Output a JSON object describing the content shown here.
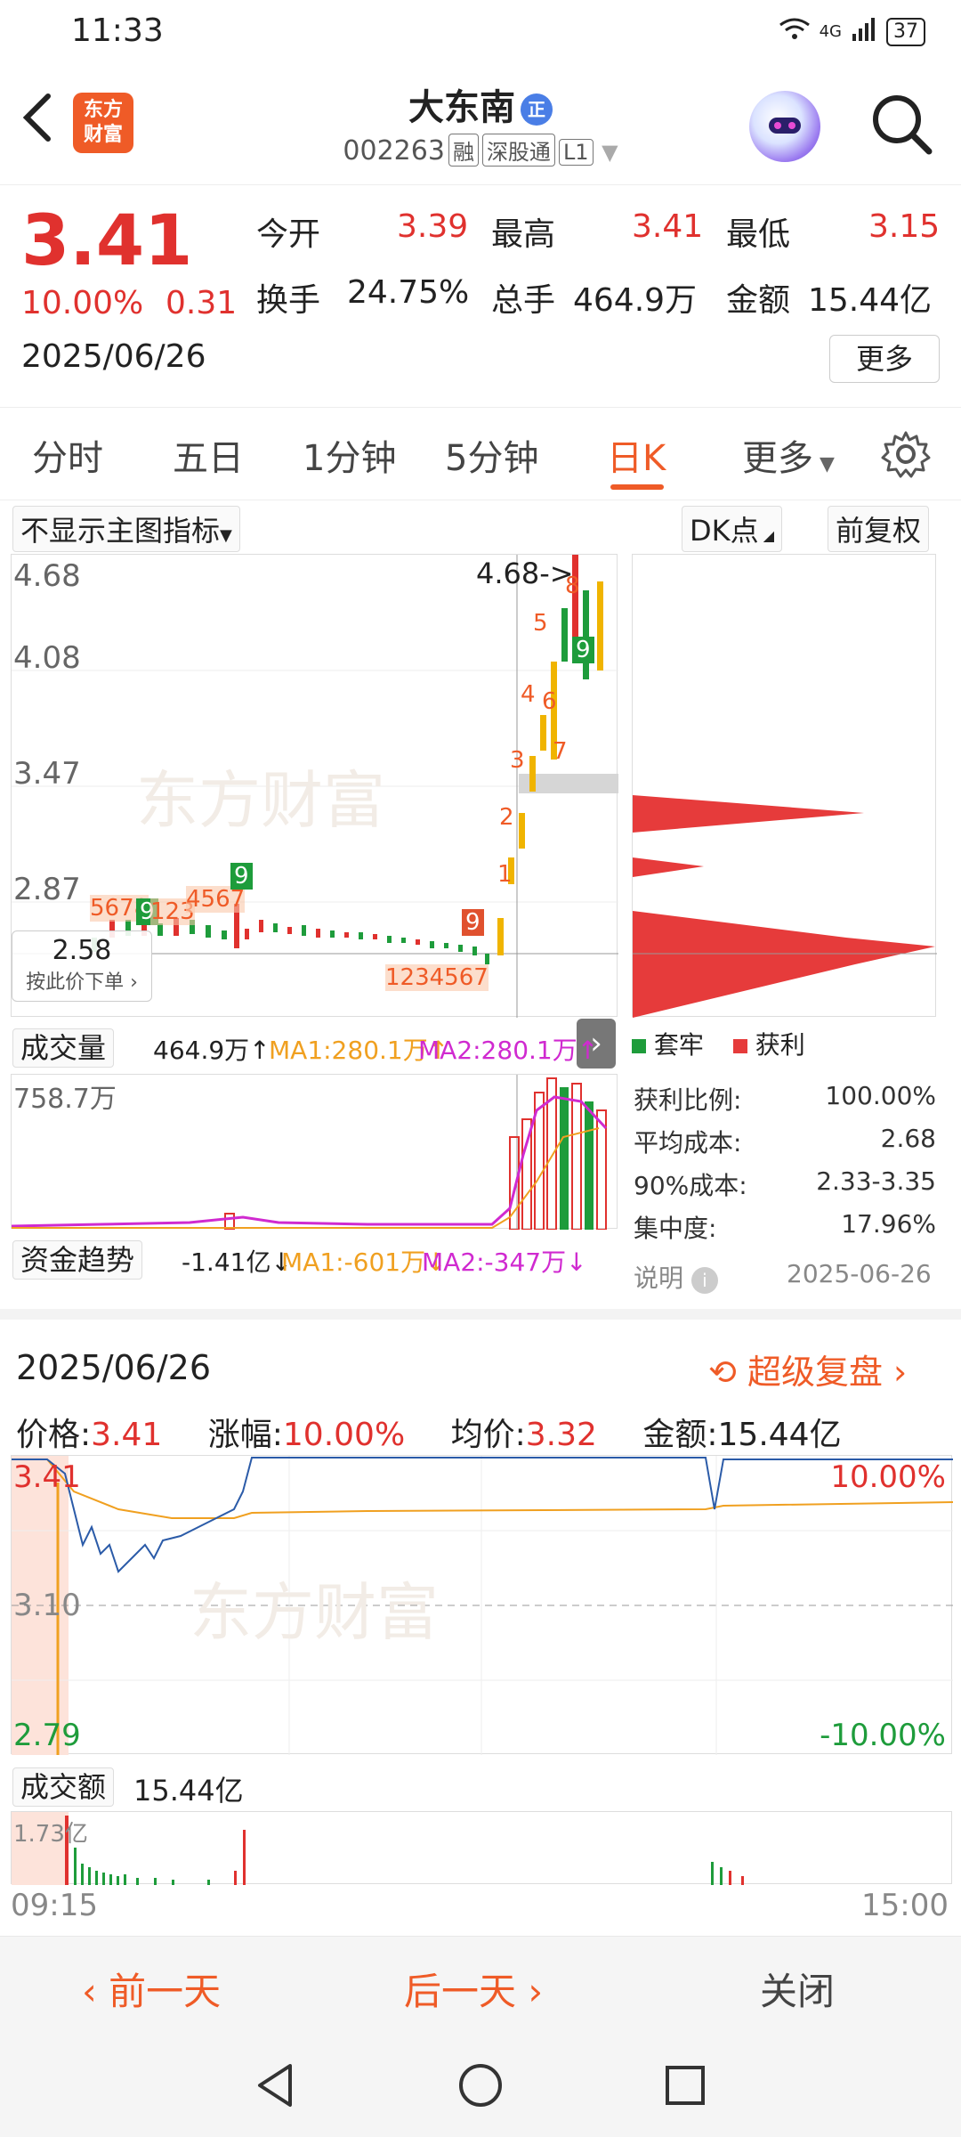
{
  "status": {
    "time": "11:33",
    "net": "4G",
    "battery": "37"
  },
  "header": {
    "name": "大东南",
    "name_badge": "正",
    "code": "002263",
    "tags": [
      "融",
      "深股通",
      "L1"
    ],
    "logo_line1": "东方",
    "logo_line2": "财富"
  },
  "quote": {
    "price": "3.41",
    "pct": "10.00%",
    "chg": "0.31",
    "date": "2025/06/26",
    "open_label": "今开",
    "open": "3.39",
    "high_label": "最高",
    "high": "3.41",
    "low_label": "最低",
    "low": "3.15",
    "turnover_label": "换手",
    "turnover": "24.75%",
    "volume_label": "总手",
    "volume": "464.9万",
    "amount_label": "金额",
    "amount": "15.44亿",
    "more": "更多"
  },
  "tabs": [
    "分时",
    "五日",
    "1分钟",
    "5分钟",
    "日K",
    "更多"
  ],
  "active_tab": "日K",
  "toolbar": {
    "indicator": "不显示主图指标",
    "dk": "DK点",
    "adjust": "前复权"
  },
  "kline": {
    "y_labels": [
      "4.68",
      "4.08",
      "3.47",
      "2.87"
    ],
    "max_label": "4.68->",
    "cursor_price": "2.58",
    "cursor_hint": "按此价下单",
    "watermark": "东方财富"
  },
  "volume": {
    "label": "成交量",
    "value": "464.9万↑",
    "ma1": "MA1:280.1万↑",
    "ma2": "MA2:280.1万↑",
    "axis_top": "758.7万"
  },
  "fund": {
    "label": "资金趋势",
    "value": "-1.41亿↓",
    "ma1": "MA1:-601万↓",
    "ma2": "MA2:-347万↓"
  },
  "chips": {
    "legend_trap": "套牢",
    "legend_profit": "获利",
    "rows": [
      {
        "label": "获利比例:",
        "value": "100.00%"
      },
      {
        "label": "平均成本:",
        "value": "2.68"
      },
      {
        "label": "90%成本:",
        "value": "2.33-3.35"
      },
      {
        "label": "集中度:",
        "value": "17.96%"
      }
    ],
    "note": "说明",
    "date": "2025-06-26"
  },
  "intraday": {
    "date": "2025/06/26",
    "replay": "超级复盘",
    "price_label": "价格:",
    "price": "3.41",
    "pct_label": "涨幅:",
    "pct": "10.00%",
    "avg_label": "均价:",
    "avg": "3.32",
    "amt_label": "金额:",
    "amt": "15.44亿",
    "y_top": "3.41",
    "y_mid": "3.10",
    "y_bot": "2.79",
    "pct_top": "10.00%",
    "pct_bot": "-10.00%",
    "amount_dropdown": "成交额",
    "amount_value": "15.44亿",
    "amount_axis": "1.73亿",
    "time_start": "09:15",
    "time_end": "15:00"
  },
  "bottom": {
    "prev": "前一天",
    "next": "后一天",
    "close": "关闭"
  },
  "colors": {
    "up": "#e0312e",
    "down": "#1e9c3b",
    "accent": "#ef5b27",
    "avg_line": "#f0a020",
    "price_line": "#2b5ba8"
  }
}
